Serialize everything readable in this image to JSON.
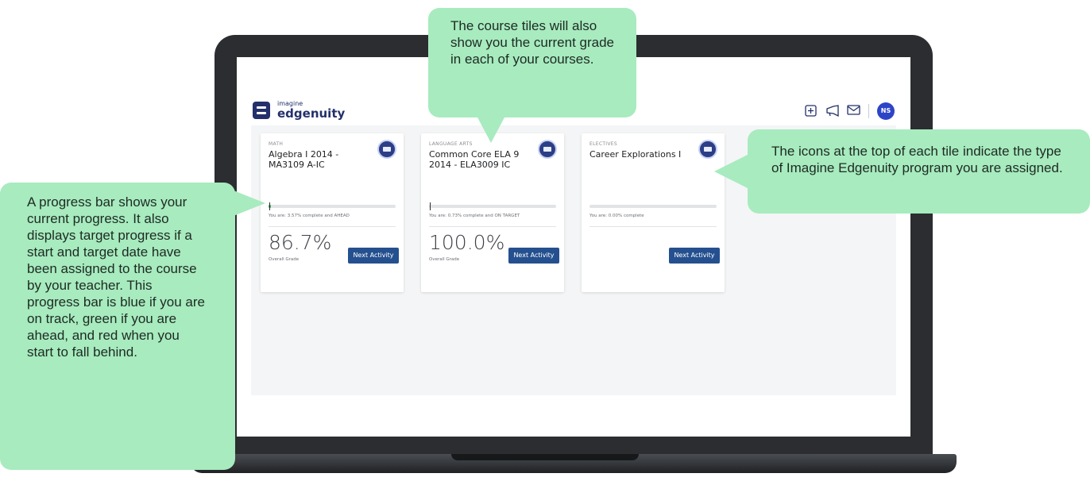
{
  "app": {
    "logo_small": "imagine",
    "logo_big": "edgenuity",
    "header_icons": [
      "plus-square-icon",
      "megaphone-icon",
      "mail-icon"
    ],
    "avatar_initials": "NS"
  },
  "courses": [
    {
      "category": "MATH",
      "title": "Algebra I 2014 - MA3109 A-IC",
      "status": "You are: 3.57% complete and AHEAD",
      "progress": 0.0357,
      "grade": "86.7%",
      "grade_label": "Overall Grade",
      "button": "Next Activity"
    },
    {
      "category": "LANGUAGE ARTS",
      "title": "Common Core ELA 9 2014 - ELA3009 IC",
      "status": "You are: 0.73% complete and ON TARGET",
      "progress": 0.0073,
      "grade": "100.0%",
      "grade_label": "Overall Grade",
      "button": "Next Activity"
    },
    {
      "category": "ELECTIVES",
      "title": "Career Explorations I",
      "status": "You are: 0.00% complete",
      "progress": 0.0,
      "grade": "",
      "grade_label": "",
      "button": "Next Activity"
    }
  ],
  "callouts": {
    "top": "The course tiles will also show you the current grade in each of your courses.",
    "right": "The icons at the top of each tile indicate the type of Imagine Edgenuity program you are assigned.",
    "left": "A progress bar shows your current progress. It also displays target progress if a start and target date have been assigned to the course by your teacher. This progress bar is blue if you are on track, green if you are ahead, and red when you start to fall behind."
  },
  "colors": {
    "callout_bg": "#a7ebbf",
    "brand_navy": "#23306b",
    "button_blue": "#25508f",
    "progress_ahead": "#3bb25a"
  }
}
